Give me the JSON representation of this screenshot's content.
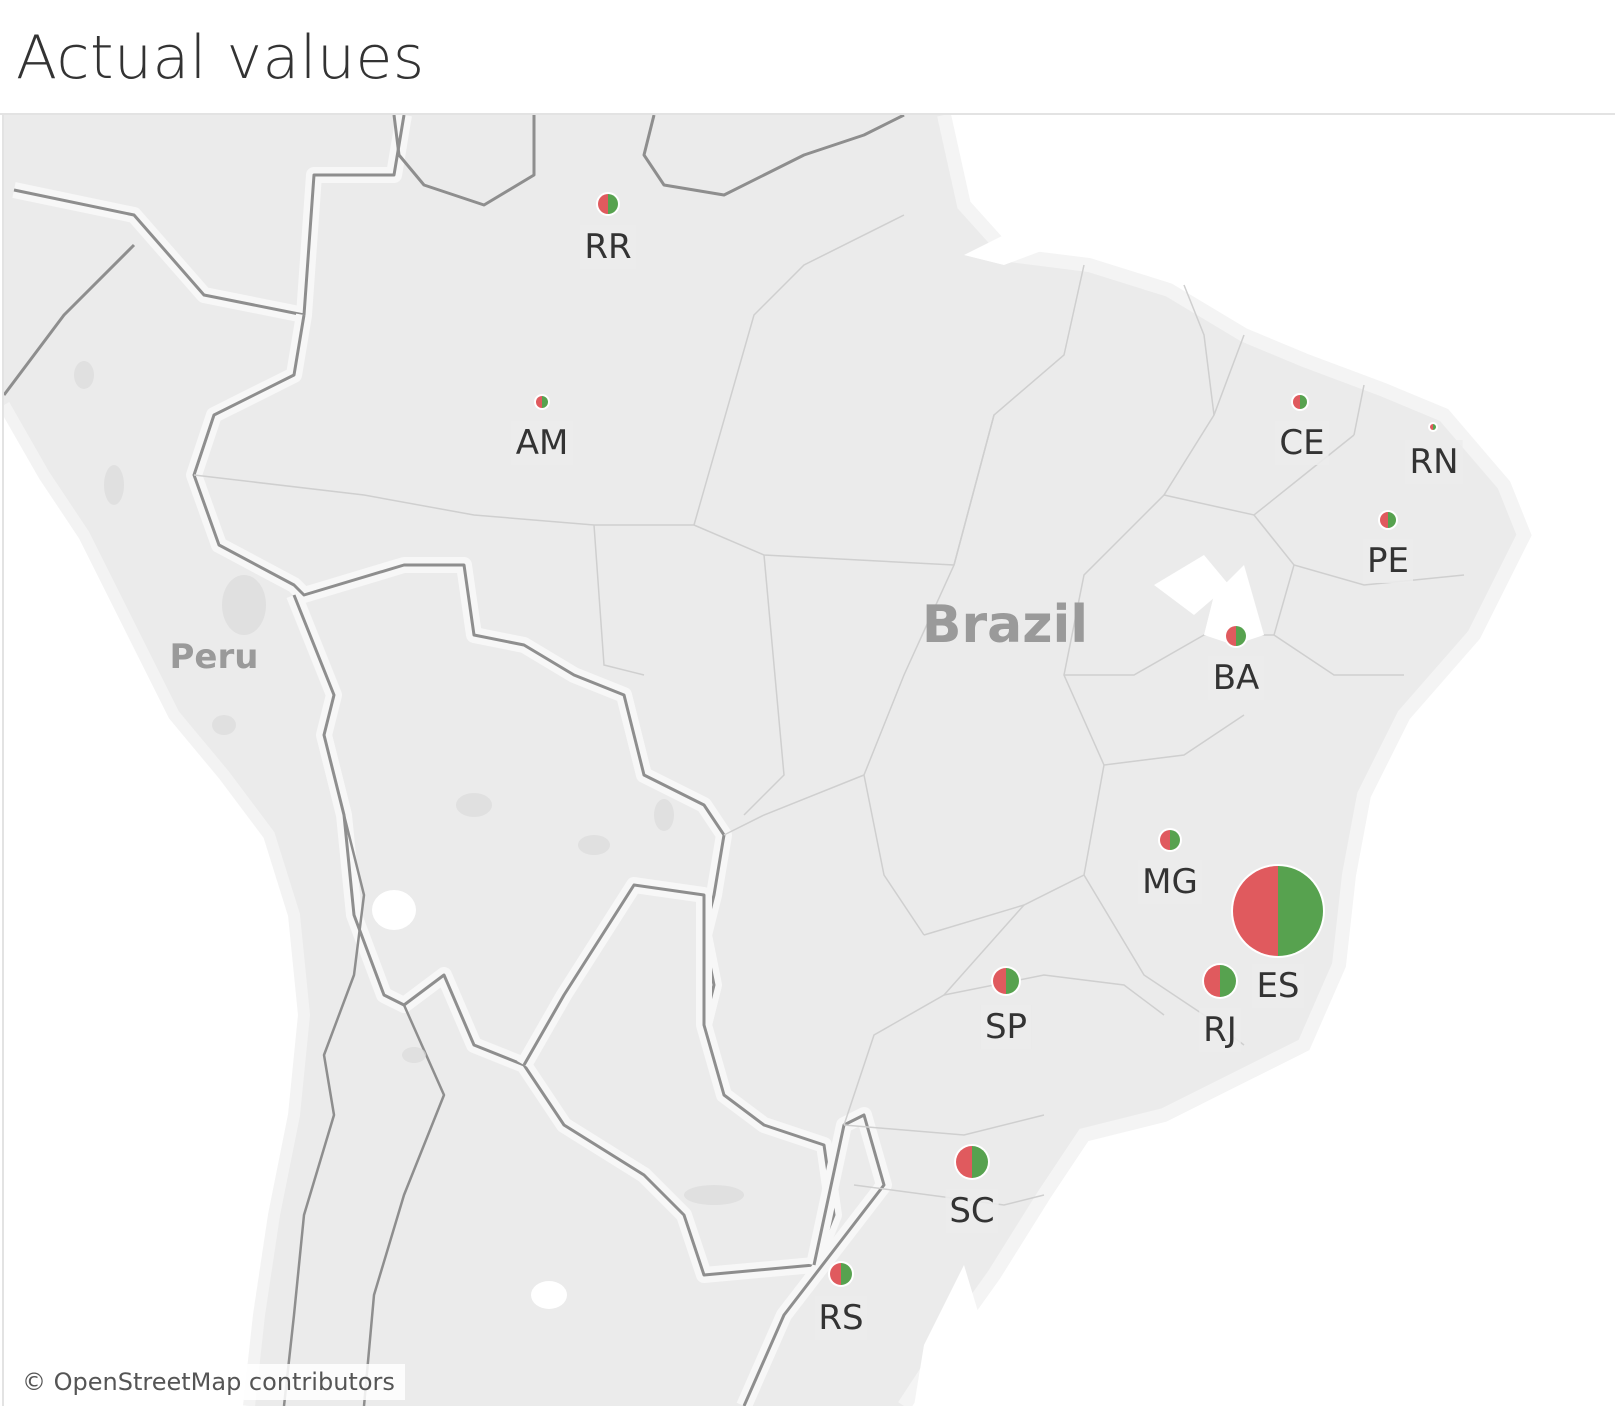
{
  "title": "Actual values",
  "attribution": "© OpenStreetMap contributors",
  "countries": {
    "brazil": "Brazil",
    "peru": "Peru"
  },
  "colors": {
    "red": "#e05a5e",
    "green": "#57a24f"
  },
  "markers": [
    {
      "code": "RR"
    },
    {
      "code": "AM"
    },
    {
      "code": "CE"
    },
    {
      "code": "RN"
    },
    {
      "code": "PE"
    },
    {
      "code": "BA"
    },
    {
      "code": "MG"
    },
    {
      "code": "ES"
    },
    {
      "code": "SP"
    },
    {
      "code": "RJ"
    },
    {
      "code": "SC"
    },
    {
      "code": "RS"
    }
  ]
}
